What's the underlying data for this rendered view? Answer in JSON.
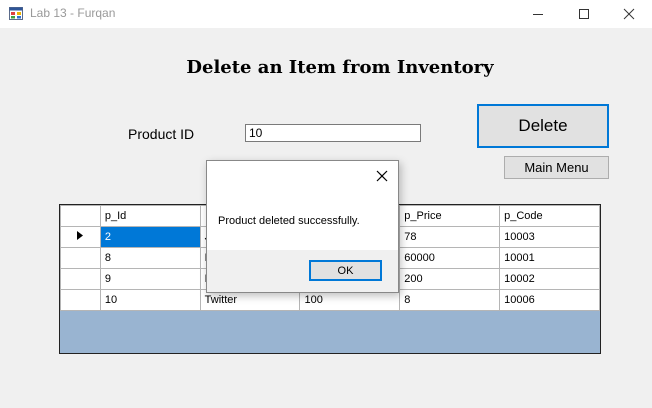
{
  "window": {
    "title": "Lab 13 - Furqan"
  },
  "form": {
    "heading": "Delete an Item from Inventory",
    "product_id_label": "Product ID",
    "product_id_value": "10",
    "delete_label": "Delete",
    "main_menu_label": "Main Menu"
  },
  "grid": {
    "columns": [
      "p_Id",
      "",
      "",
      "p_Price",
      "p_Code"
    ],
    "rows": [
      [
        "2",
        "J",
        "",
        "78",
        "10003"
      ],
      [
        "8",
        "H",
        "",
        "60000",
        "10001"
      ],
      [
        "9",
        "E",
        "",
        "200",
        "10002"
      ],
      [
        "10",
        "Twitter",
        "100",
        "8",
        "10006"
      ]
    ],
    "selected_row": 0,
    "background_color": "#99b4d1",
    "selection_color": "#0078d7"
  },
  "dialog": {
    "message": "Product deleted successfully.",
    "ok_label": "OK"
  },
  "colors": {
    "accent": "#0078d7",
    "window_bg": "#f0f0f0"
  },
  "icons": [
    "app-icon",
    "minimize-icon",
    "maximize-icon",
    "close-icon",
    "row-pointer-icon",
    "dialog-close-icon"
  ]
}
